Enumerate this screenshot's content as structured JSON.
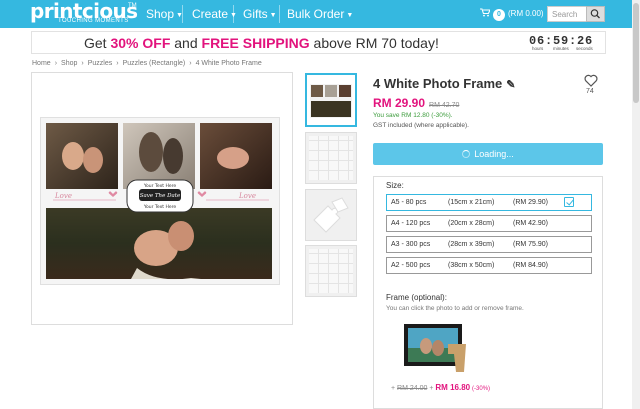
{
  "brand": {
    "name": "printcious",
    "tagline": "TOUCHING MOMENTS",
    "tm": "TM",
    "color": "#35b8e0"
  },
  "nav": {
    "items": [
      {
        "label": "Shop"
      },
      {
        "label": "Create"
      },
      {
        "label": "Gifts"
      },
      {
        "label": "Bulk Order"
      }
    ],
    "cart_count": "0",
    "cart_total": "(RM 0.00)",
    "search_placeholder": "Search"
  },
  "promo": {
    "pre": "Get",
    "discount": "30% OFF",
    "mid": "and",
    "shipping": "FREE SHIPPING",
    "post": "above RM 70 today!",
    "countdown": {
      "value": "06:59:26",
      "labels": [
        "hours",
        "minutes",
        "seconds"
      ]
    }
  },
  "breadcrumb": [
    "Home",
    "Shop",
    "Puzzles",
    "Puzzles (Rectangle)",
    "4 White Photo Frame"
  ],
  "artwork_text": {
    "love_left": "Love",
    "love_right": "Love",
    "your_text_here_1": "Your Text Here",
    "save_the_date": "Save The Date",
    "your_text_here_2": "Your Text Here"
  },
  "product": {
    "title": "4 White Photo Frame",
    "edit_icon": "pencil-icon",
    "likes": "74",
    "price": "RM 29.90",
    "old_price": "RM 42.70",
    "savings": "You save RM 12.80 (-30%).",
    "gst": "GST included (where applicable).",
    "loading_label": "Loading...",
    "pink": "#e2137d"
  },
  "size": {
    "label": "Size:",
    "options": [
      {
        "name": "A5 - 80 pcs",
        "dims": "(15cm x 21cm)",
        "price": "(RM 29.90)",
        "selected": true
      },
      {
        "name": "A4 - 120 pcs",
        "dims": "(20cm x 28cm)",
        "price": "(RM 42.90)",
        "selected": false
      },
      {
        "name": "A3 - 300 pcs",
        "dims": "(28cm x 39cm)",
        "price": "(RM 75.90)",
        "selected": false
      },
      {
        "name": "A2 - 500 pcs",
        "dims": "(38cm x 50cm)",
        "price": "(RM 84.90)",
        "selected": false
      }
    ]
  },
  "frame": {
    "label": "Frame (optional):",
    "hint": "You can click the photo to add or remove frame.",
    "old_price": "RM 24.00",
    "plus": "+",
    "new_price": "RM 16.80",
    "discount": "(-30%)"
  }
}
